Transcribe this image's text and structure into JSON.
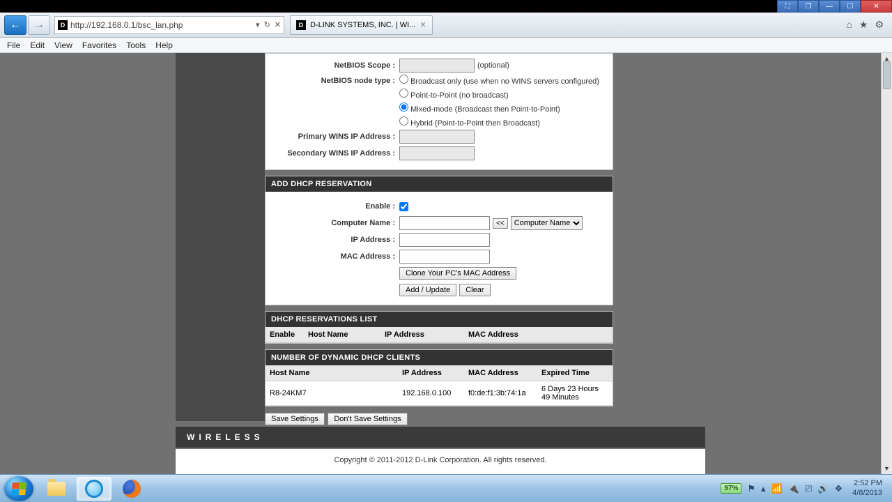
{
  "window": {
    "url": "http://192.168.0.1/bsc_lan.php",
    "tab_title": "D-LINK SYSTEMS, INC. | WI..."
  },
  "menu": [
    "File",
    "Edit",
    "View",
    "Favorites",
    "Tools",
    "Help"
  ],
  "netbios": {
    "scope_label": "NetBIOS Scope :",
    "scope_hint": "(optional)",
    "node_label": "NetBIOS node type :",
    "opts": [
      "Broadcast only (use when no WINS servers configured)",
      "Point-to-Point (no broadcast)",
      "Mixed-mode (Broadcast then Point-to-Point)",
      "Hybrid (Point-to-Point then Broadcast)"
    ],
    "primary_label": "Primary WINS IP Address :",
    "secondary_label": "Secondary WINS IP Address :"
  },
  "reservation": {
    "header": "ADD DHCP RESERVATION",
    "enable_label": "Enable :",
    "computer_name_label": "Computer Name :",
    "ip_label": "IP Address :",
    "mac_label": "MAC Address :",
    "dropdown_label": "Computer Name",
    "clone_btn": "Clone Your PC's MAC Address",
    "add_btn": "Add / Update",
    "clear_btn": "Clear"
  },
  "res_list": {
    "header": "DHCP RESERVATIONS LIST",
    "cols": [
      "Enable",
      "Host Name",
      "IP Address",
      "MAC Address"
    ]
  },
  "clients": {
    "header": "NUMBER OF DYNAMIC DHCP CLIENTS",
    "cols": [
      "Host Name",
      "IP Address",
      "MAC Address",
      "Expired Time"
    ],
    "rows": [
      {
        "host": "R8-24KM7",
        "ip": "192.168.0.100",
        "mac": "f0:de:f1:3b:74:1a",
        "exp": "6 Days 23 Hours 49 Minutes"
      }
    ]
  },
  "save_row": {
    "save": "Save Settings",
    "dont": "Don't Save Settings"
  },
  "footer_brand": "WIRELESS",
  "copyright": "Copyright © 2011-2012 D-Link Corporation. All rights reserved.",
  "tray": {
    "battery": "97%",
    "time": "2:52 PM",
    "date": "4/8/2013"
  }
}
